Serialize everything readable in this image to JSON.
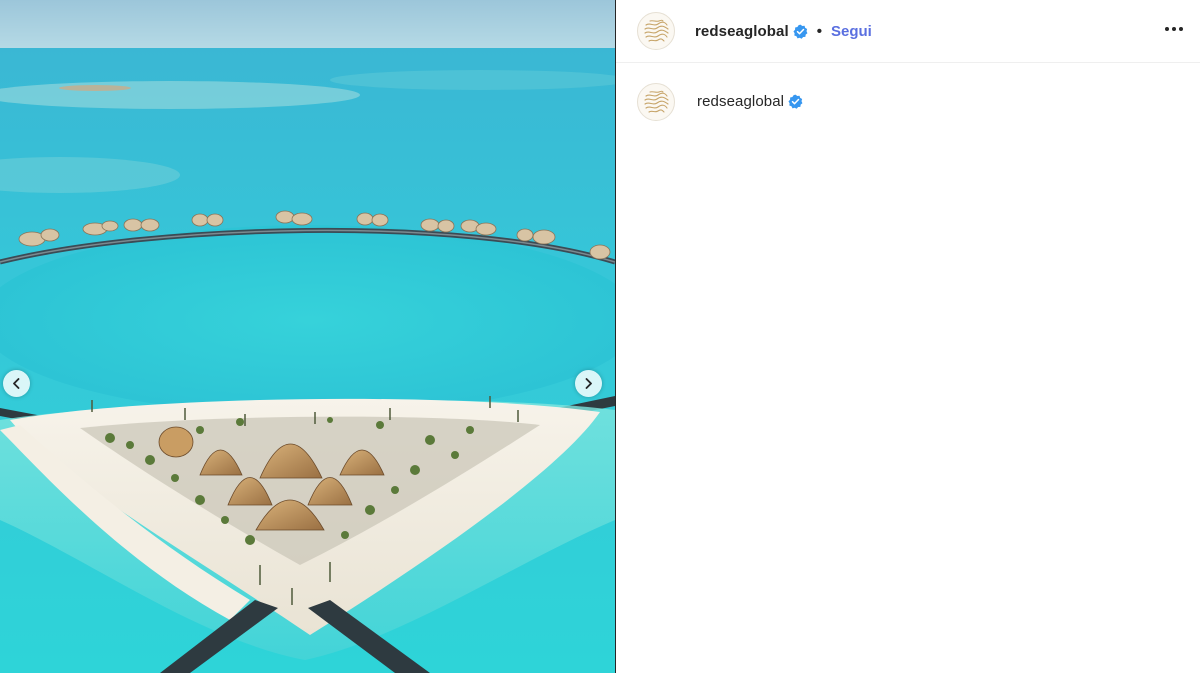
{
  "post": {
    "account": {
      "username": "redseaglobal",
      "verified": true,
      "avatar_icon": "redseaglobal-logo-icon"
    },
    "header": {
      "separator": "•",
      "follow_label": "Segui",
      "more_icon": "more-options-icon"
    },
    "caption": {
      "username": "redseaglobal"
    },
    "media": {
      "description_icon": "aerial-resort-photo",
      "prev_icon": "chevron-left-icon",
      "next_icon": "chevron-right-icon"
    }
  },
  "colors": {
    "follow": "#5a6fe0",
    "verified_badge": "#3797f0",
    "text": "#262626",
    "divider": "#efefef"
  }
}
